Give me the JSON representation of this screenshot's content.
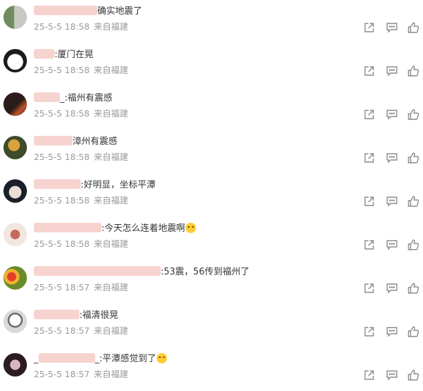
{
  "comments": [
    {
      "name_visible": "",
      "text": "确实地震了",
      "date": "25-5-5 18:58",
      "source": "来自福建",
      "avatar_colors": [
        "#6f8c5e",
        "#c9c9c4"
      ],
      "emoji": ""
    },
    {
      "name_visible": "",
      "text": ":厦门在晃",
      "date": "25-5-5 18:58",
      "source": "来自福建",
      "avatar_colors": [
        "#1c1c1c",
        "#ffffff"
      ],
      "emoji": ""
    },
    {
      "name_visible": "",
      "text": "_:福州有震感",
      "date": "25-5-5 18:58",
      "source": "来自福建",
      "avatar_colors": [
        "#2a1c18",
        "#c0542c"
      ],
      "emoji": ""
    },
    {
      "name_visible": "",
      "text": "漳州有震感",
      "date": "25-5-5 18:58",
      "source": "来自福建",
      "avatar_colors": [
        "#3f4a2a",
        "#d8a33a"
      ],
      "emoji": ""
    },
    {
      "name_visible": "",
      "text": ":好明显，坐标平潭",
      "date": "25-5-5 18:58",
      "source": "来自福建",
      "avatar_colors": [
        "#1c1f28",
        "#e8ded6"
      ],
      "emoji": ""
    },
    {
      "name_visible": "",
      "text": ":今天怎么连着地震啊",
      "date": "25-5-5 18:58",
      "source": "来自福建",
      "avatar_colors": [
        "#f2e6e0",
        "#c46a5c"
      ],
      "emoji": "crying-face"
    },
    {
      "name_visible": "",
      "text": ":53震，56传到福州了",
      "date": "25-5-5 18:57",
      "source": "来自福建",
      "avatar_colors": [
        "#6a8b2a",
        "#e2402a"
      ],
      "emoji": ""
    },
    {
      "name_visible": "",
      "text": ":福清很晃",
      "date": "25-5-5 18:57",
      "source": "来自福建",
      "avatar_colors": [
        "#d9d9d9",
        "#6b6b6b"
      ],
      "emoji": ""
    },
    {
      "name_visible": "_",
      "text": "_:平潭感觉到了",
      "date": "25-5-5 18:57",
      "source": "来自福建",
      "avatar_colors": [
        "#2b1b22",
        "#d8b6c0"
      ],
      "emoji": "crying-laughing-face"
    }
  ],
  "icons": {
    "share": "share-icon",
    "comment": "comment-icon",
    "like": "like-icon"
  },
  "colors": {
    "meta": "#999999",
    "icon": "#8a8a8a",
    "redaction": "#f7d3d0"
  }
}
